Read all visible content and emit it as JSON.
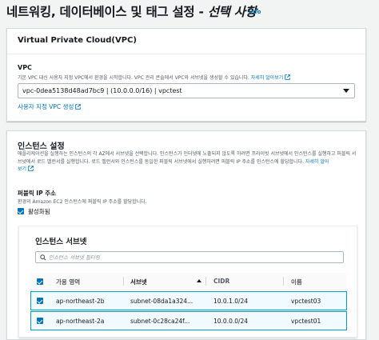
{
  "page": {
    "title": "네트워킹, 데이터베이스 및 태그 설정 - ",
    "title_italic": "선택 사항",
    "info_label": "Info"
  },
  "vpc": {
    "panel_title": "Virtual Private Cloud(VPC)",
    "field_label": "VPC",
    "description": "기본 VPC 대신 사용자 지정 VPC에서 환경을 시작합니다. VPC 관리 콘솔에서 VPC와 서브넷을 생성할 수 있습니다. ",
    "learn_more": "자세히 알아보기",
    "selected_value": "vpc-0dea5138d48ad7bc9 | (10.0.0.0/16) | vpctest",
    "create_link": "사용자 지정 VPC 생성"
  },
  "instance": {
    "panel_title": "인스턴스 설정",
    "description": "애플리케이션을 실행하는 인스턴스의 각 AZ에서 서브넷을 선택합니다. 인스턴스가 인터넷에 노출되지 않도록 하려면 프라이빗 서브넷에서 인스턴스를 실행하고 퍼블릭 서브넷에서 로드 밸런서를 실행합니다. 로드 밸런서와 인스턴스를 동일한 퍼블릭 서브넷에서 실행하려면 퍼블릭 IP 주소를 인스턴스에 할당합니다. ",
    "learn_more_1": "자세히 알아",
    "learn_more_2": "보기",
    "public_ip": {
      "label": "퍼블릭 IP 주소",
      "description": "환경의 Amazon EC2 인스턴스에 퍼블릭 IP 주소를 할당합니다.",
      "checkbox_label": "활성화됨"
    }
  },
  "subnets": {
    "title": "인스턴스 서브넷",
    "filter_placeholder": "인스턴스 서브넷 필터링",
    "columns": {
      "zone": "가용 영역",
      "subnet": "서브넷",
      "cidr": "CIDR",
      "name": "이름"
    },
    "rows": [
      {
        "zone": "ap-northeast-2b",
        "subnet": "subnet-08da1a324...",
        "cidr": "10.0.1.0/24",
        "name": "vpctest03"
      },
      {
        "zone": "ap-northeast-2a",
        "subnet": "subnet-0c28ca24f...",
        "cidr": "10.0.0.0/24",
        "name": "vpctest01"
      }
    ]
  },
  "colors": {
    "link": "#0073bb",
    "checkbox": "#0073bb",
    "selected_row_bg": "#f1faff",
    "selected_row_border": "#00a1c9"
  },
  "icons": [
    "external-link-icon",
    "caret-down-icon",
    "search-icon",
    "checkbox-checked-icon",
    "sort-ascending-icon"
  ]
}
